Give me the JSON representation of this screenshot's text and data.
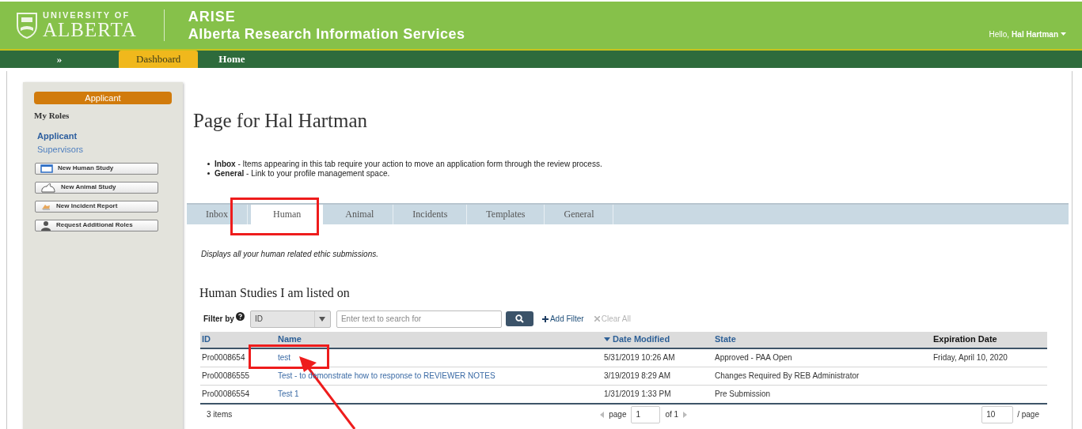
{
  "header": {
    "logo_top": "UNIVERSITY OF",
    "logo_bottom": "ALBERTA",
    "app_title": "ARISE",
    "app_subtitle": "Alberta Research Information Services",
    "greeting": "Hello,",
    "user": "Hal Hartman"
  },
  "nav": {
    "expand": "»",
    "tabs": [
      {
        "label": "Dashboard",
        "selected": true
      },
      {
        "label": "Home",
        "selected": false
      }
    ]
  },
  "sidebar": {
    "role_badge": "Applicant",
    "section": "My Roles",
    "roles": [
      {
        "label": "Applicant",
        "selected": true
      },
      {
        "label": "Supervisors",
        "selected": false
      }
    ],
    "actions": [
      {
        "label": "New Human Study",
        "kind": "window"
      },
      {
        "label": "New Animal Study",
        "kind": "animal"
      },
      {
        "label": "New Incident Report",
        "kind": "incident"
      },
      {
        "label": "Request Additional Roles",
        "kind": "person"
      }
    ]
  },
  "page_title": "Page for Hal Hartman",
  "bullets": [
    "**Inbox**  - Items appearing in this tab require your action to move an application form through the review process.",
    "**General** - Link to your profile management space."
  ],
  "tabs": [
    {
      "label": "Inbox",
      "selected": false
    },
    {
      "label": "Human",
      "selected": true
    },
    {
      "label": "Animal",
      "selected": false
    },
    {
      "label": "Incidents",
      "selected": false
    },
    {
      "label": "Templates",
      "selected": false
    },
    {
      "label": "General",
      "selected": false
    }
  ],
  "description": "Displays all your human related ethic submissions.",
  "section_title": "Human Studies I am listed on",
  "filter": {
    "label": "Filter by",
    "select_value": "ID",
    "search_placeholder": "Enter text to search for",
    "add_filter": "Add Filter",
    "clear_all": "Clear All",
    "clear_disabled": true
  },
  "table": {
    "columns": [
      {
        "label": "ID",
        "link": true,
        "sorted": false
      },
      {
        "label": "Name",
        "link": true,
        "sorted": false
      },
      {
        "label": "Date Modified",
        "link": true,
        "sorted": true
      },
      {
        "label": "State",
        "link": true,
        "sorted": false
      },
      {
        "label": "Expiration Date",
        "link": false,
        "sorted": false
      }
    ],
    "rows": [
      {
        "id": "Pro0008654",
        "name": "test",
        "date": "5/31/2019 10:26 AM",
        "state": "Approved - PAA Open",
        "expiration": "Friday, April 10, 2020"
      },
      {
        "id": "Pro00086555",
        "name": "Test - to demonstrate how to response to REVIEWER NOTES",
        "date": "3/19/2019 8:29 AM",
        "state": "Changes Required By REB Administrator"
      },
      {
        "id": "Pro00086554",
        "name": "Test 1",
        "date": "1/31/2019 1:33 PM",
        "state": "Pre Submission"
      }
    ]
  },
  "pager": {
    "count": "3 items",
    "page_label": "page",
    "page_value": "1",
    "of": "of 1",
    "per_page_value": "10",
    "per_page_label": "/ page"
  }
}
